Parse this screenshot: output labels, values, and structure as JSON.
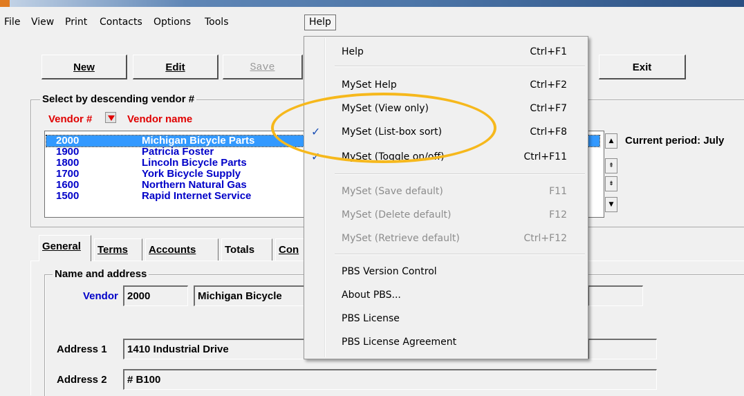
{
  "menubar": {
    "items": [
      "File",
      "View",
      "Print",
      "Contacts",
      "Options",
      "Tools",
      "Help"
    ]
  },
  "toolbar": {
    "new_label": "New",
    "edit_label": "Edit",
    "save_label": "Save",
    "exit_label": "Exit"
  },
  "select_group": {
    "label": "Select by descending vendor #",
    "col_vendor": "Vendor #",
    "col_name": "Vendor name",
    "rows": [
      {
        "num": "2000",
        "name": "Michigan Bicycle Parts"
      },
      {
        "num": "1900",
        "name": "Patricia Foster"
      },
      {
        "num": "1800",
        "name": "Lincoln Bicycle Parts"
      },
      {
        "num": "1700",
        "name": "York Bicycle Supply"
      },
      {
        "num": "1600",
        "name": "Northern Natural Gas"
      },
      {
        "num": "1500",
        "name": "Rapid Internet Service"
      }
    ],
    "current_period": "Current period: July"
  },
  "tabs": [
    "General",
    "Terms",
    "Accounts",
    "Totals",
    "Con"
  ],
  "name_address": {
    "label": "Name and address",
    "vendor_label": "Vendor",
    "vendor_value": "2000",
    "vendor_name": "Michigan Bicycle",
    "address1_label": "Address 1",
    "address1_value": "1410 Industrial Drive",
    "address2_label": "Address 2",
    "address2_value": "# B100"
  },
  "help_menu": {
    "items": [
      {
        "label": "Help",
        "shortcut": "Ctrl+F1"
      },
      {
        "label": "MySet Help",
        "shortcut": "Ctrl+F2"
      },
      {
        "label": "MySet (View only)",
        "shortcut": "Ctrl+F7"
      },
      {
        "label": "MySet (List-box sort)",
        "shortcut": "Ctrl+F8",
        "checked": true
      },
      {
        "label": "MySet (Toggle on/off)",
        "shortcut": "Ctrl+F11",
        "checked": true
      },
      {
        "label": "MySet (Save default)",
        "shortcut": "F11",
        "disabled": true
      },
      {
        "label": "MySet (Delete default)",
        "shortcut": "F12",
        "disabled": true
      },
      {
        "label": "MySet (Retrieve default)",
        "shortcut": "Ctrl+F12",
        "disabled": true
      },
      {
        "label": "PBS Version Control",
        "shortcut": ""
      },
      {
        "label": "About PBS...",
        "shortcut": ""
      },
      {
        "label": "PBS License",
        "shortcut": ""
      },
      {
        "label": "PBS License Agreement",
        "shortcut": ""
      }
    ],
    "check_mark": "✓"
  },
  "colors": {
    "accent_selection": "#3399ff",
    "vendor_text": "#0000c8",
    "header_red": "#e00000",
    "highlight_ring": "#f6b81c"
  }
}
